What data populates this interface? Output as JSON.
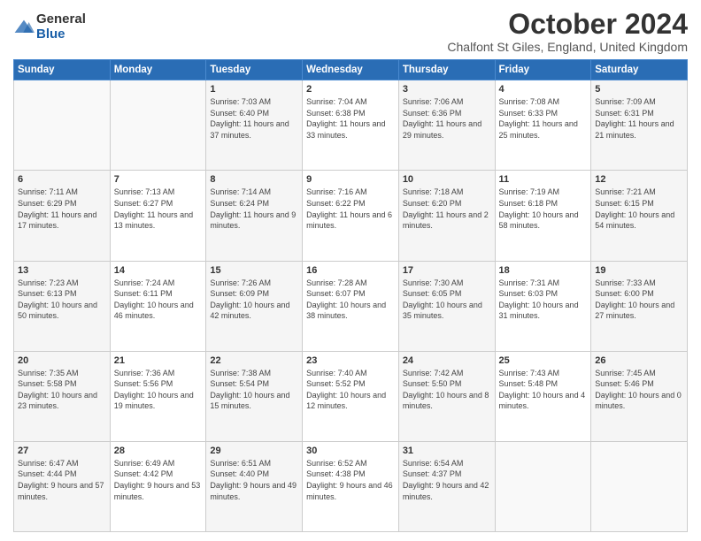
{
  "logo": {
    "general": "General",
    "blue": "Blue"
  },
  "title": "October 2024",
  "location": "Chalfont St Giles, England, United Kingdom",
  "weekdays": [
    "Sunday",
    "Monday",
    "Tuesday",
    "Wednesday",
    "Thursday",
    "Friday",
    "Saturday"
  ],
  "weeks": [
    [
      {
        "day": "",
        "sunrise": "",
        "sunset": "",
        "daylight": ""
      },
      {
        "day": "",
        "sunrise": "",
        "sunset": "",
        "daylight": ""
      },
      {
        "day": "1",
        "sunrise": "Sunrise: 7:03 AM",
        "sunset": "Sunset: 6:40 PM",
        "daylight": "Daylight: 11 hours and 37 minutes."
      },
      {
        "day": "2",
        "sunrise": "Sunrise: 7:04 AM",
        "sunset": "Sunset: 6:38 PM",
        "daylight": "Daylight: 11 hours and 33 minutes."
      },
      {
        "day": "3",
        "sunrise": "Sunrise: 7:06 AM",
        "sunset": "Sunset: 6:36 PM",
        "daylight": "Daylight: 11 hours and 29 minutes."
      },
      {
        "day": "4",
        "sunrise": "Sunrise: 7:08 AM",
        "sunset": "Sunset: 6:33 PM",
        "daylight": "Daylight: 11 hours and 25 minutes."
      },
      {
        "day": "5",
        "sunrise": "Sunrise: 7:09 AM",
        "sunset": "Sunset: 6:31 PM",
        "daylight": "Daylight: 11 hours and 21 minutes."
      }
    ],
    [
      {
        "day": "6",
        "sunrise": "Sunrise: 7:11 AM",
        "sunset": "Sunset: 6:29 PM",
        "daylight": "Daylight: 11 hours and 17 minutes."
      },
      {
        "day": "7",
        "sunrise": "Sunrise: 7:13 AM",
        "sunset": "Sunset: 6:27 PM",
        "daylight": "Daylight: 11 hours and 13 minutes."
      },
      {
        "day": "8",
        "sunrise": "Sunrise: 7:14 AM",
        "sunset": "Sunset: 6:24 PM",
        "daylight": "Daylight: 11 hours and 9 minutes."
      },
      {
        "day": "9",
        "sunrise": "Sunrise: 7:16 AM",
        "sunset": "Sunset: 6:22 PM",
        "daylight": "Daylight: 11 hours and 6 minutes."
      },
      {
        "day": "10",
        "sunrise": "Sunrise: 7:18 AM",
        "sunset": "Sunset: 6:20 PM",
        "daylight": "Daylight: 11 hours and 2 minutes."
      },
      {
        "day": "11",
        "sunrise": "Sunrise: 7:19 AM",
        "sunset": "Sunset: 6:18 PM",
        "daylight": "Daylight: 10 hours and 58 minutes."
      },
      {
        "day": "12",
        "sunrise": "Sunrise: 7:21 AM",
        "sunset": "Sunset: 6:15 PM",
        "daylight": "Daylight: 10 hours and 54 minutes."
      }
    ],
    [
      {
        "day": "13",
        "sunrise": "Sunrise: 7:23 AM",
        "sunset": "Sunset: 6:13 PM",
        "daylight": "Daylight: 10 hours and 50 minutes."
      },
      {
        "day": "14",
        "sunrise": "Sunrise: 7:24 AM",
        "sunset": "Sunset: 6:11 PM",
        "daylight": "Daylight: 10 hours and 46 minutes."
      },
      {
        "day": "15",
        "sunrise": "Sunrise: 7:26 AM",
        "sunset": "Sunset: 6:09 PM",
        "daylight": "Daylight: 10 hours and 42 minutes."
      },
      {
        "day": "16",
        "sunrise": "Sunrise: 7:28 AM",
        "sunset": "Sunset: 6:07 PM",
        "daylight": "Daylight: 10 hours and 38 minutes."
      },
      {
        "day": "17",
        "sunrise": "Sunrise: 7:30 AM",
        "sunset": "Sunset: 6:05 PM",
        "daylight": "Daylight: 10 hours and 35 minutes."
      },
      {
        "day": "18",
        "sunrise": "Sunrise: 7:31 AM",
        "sunset": "Sunset: 6:03 PM",
        "daylight": "Daylight: 10 hours and 31 minutes."
      },
      {
        "day": "19",
        "sunrise": "Sunrise: 7:33 AM",
        "sunset": "Sunset: 6:00 PM",
        "daylight": "Daylight: 10 hours and 27 minutes."
      }
    ],
    [
      {
        "day": "20",
        "sunrise": "Sunrise: 7:35 AM",
        "sunset": "Sunset: 5:58 PM",
        "daylight": "Daylight: 10 hours and 23 minutes."
      },
      {
        "day": "21",
        "sunrise": "Sunrise: 7:36 AM",
        "sunset": "Sunset: 5:56 PM",
        "daylight": "Daylight: 10 hours and 19 minutes."
      },
      {
        "day": "22",
        "sunrise": "Sunrise: 7:38 AM",
        "sunset": "Sunset: 5:54 PM",
        "daylight": "Daylight: 10 hours and 15 minutes."
      },
      {
        "day": "23",
        "sunrise": "Sunrise: 7:40 AM",
        "sunset": "Sunset: 5:52 PM",
        "daylight": "Daylight: 10 hours and 12 minutes."
      },
      {
        "day": "24",
        "sunrise": "Sunrise: 7:42 AM",
        "sunset": "Sunset: 5:50 PM",
        "daylight": "Daylight: 10 hours and 8 minutes."
      },
      {
        "day": "25",
        "sunrise": "Sunrise: 7:43 AM",
        "sunset": "Sunset: 5:48 PM",
        "daylight": "Daylight: 10 hours and 4 minutes."
      },
      {
        "day": "26",
        "sunrise": "Sunrise: 7:45 AM",
        "sunset": "Sunset: 5:46 PM",
        "daylight": "Daylight: 10 hours and 0 minutes."
      }
    ],
    [
      {
        "day": "27",
        "sunrise": "Sunrise: 6:47 AM",
        "sunset": "Sunset: 4:44 PM",
        "daylight": "Daylight: 9 hours and 57 minutes."
      },
      {
        "day": "28",
        "sunrise": "Sunrise: 6:49 AM",
        "sunset": "Sunset: 4:42 PM",
        "daylight": "Daylight: 9 hours and 53 minutes."
      },
      {
        "day": "29",
        "sunrise": "Sunrise: 6:51 AM",
        "sunset": "Sunset: 4:40 PM",
        "daylight": "Daylight: 9 hours and 49 minutes."
      },
      {
        "day": "30",
        "sunrise": "Sunrise: 6:52 AM",
        "sunset": "Sunset: 4:38 PM",
        "daylight": "Daylight: 9 hours and 46 minutes."
      },
      {
        "day": "31",
        "sunrise": "Sunrise: 6:54 AM",
        "sunset": "Sunset: 4:37 PM",
        "daylight": "Daylight: 9 hours and 42 minutes."
      },
      {
        "day": "",
        "sunrise": "",
        "sunset": "",
        "daylight": ""
      },
      {
        "day": "",
        "sunrise": "",
        "sunset": "",
        "daylight": ""
      }
    ]
  ]
}
